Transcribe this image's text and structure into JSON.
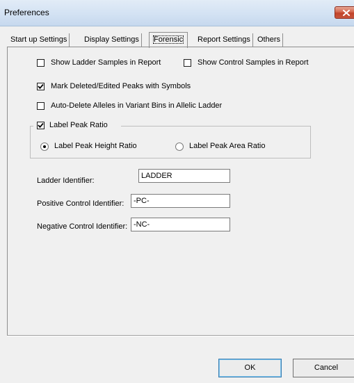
{
  "window": {
    "title": "Preferences"
  },
  "tabs": [
    {
      "label": "Start up Settings"
    },
    {
      "label": "Display Settings"
    },
    {
      "label": "Forensic",
      "active": true
    },
    {
      "label": "Report Settings"
    },
    {
      "label": "Others"
    }
  ],
  "options": {
    "show_ladder_samples": {
      "label": "Show Ladder Samples in Report",
      "checked": false
    },
    "show_control_samples": {
      "label": "Show Control Samples in Report",
      "checked": false
    },
    "mark_deleted_peaks": {
      "label": "Mark Deleted/Edited Peaks with Symbols",
      "checked": true
    },
    "auto_delete_alleles": {
      "label": "Auto-Delete Alleles in Variant Bins in Allelic Ladder",
      "checked": false
    }
  },
  "peak_ratio": {
    "label": "Label Peak Ratio",
    "checked": true,
    "height_ratio_label": "Label Peak Height Ratio",
    "area_ratio_label": "Label Peak Area Ratio",
    "selected": "height"
  },
  "fields": {
    "ladder": {
      "label": "Ladder Identifier:",
      "value": "LADDER"
    },
    "positive": {
      "label": "Positive Control Identifier:",
      "value": "-PC-"
    },
    "negative": {
      "label": "Negative Control Identifier:",
      "value": "-NC-"
    }
  },
  "buttons": {
    "ok": "OK",
    "cancel": "Cancel"
  }
}
